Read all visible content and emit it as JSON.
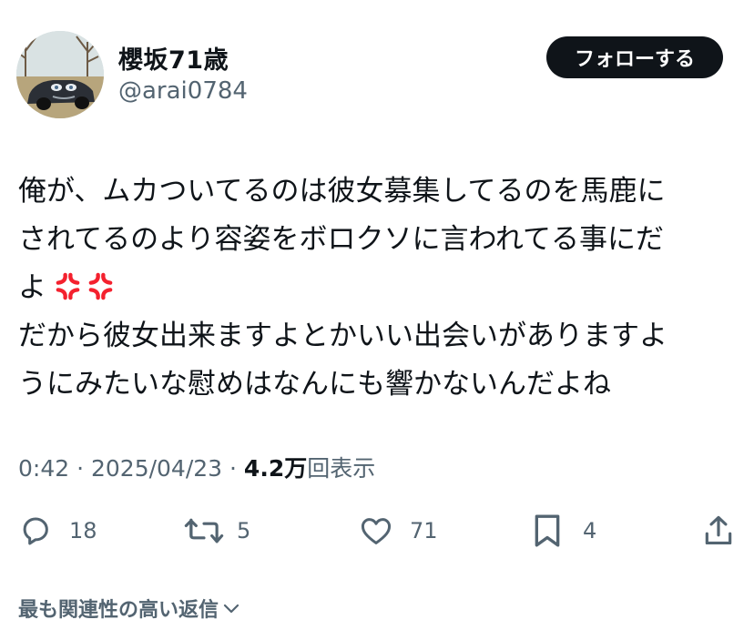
{
  "author": {
    "display_name": "櫻坂71歳",
    "handle": "@arai0784",
    "avatar_icon": "car-avatar"
  },
  "follow_label": "フォローする",
  "tweet": {
    "lines": [
      "俺が、ムカついてるのは彼女募集してるのを馬鹿に",
      "されてるのより容姿をボロクソに言われてる事にだ",
      "よ",
      "だから彼女出来ますよとかいい出会いがありますよ",
      "うにみたいな慰めはなんにも響かないんだよね"
    ],
    "emoji": "anger-symbol-icon"
  },
  "meta": {
    "time": "0:42",
    "sep1": " · ",
    "date": "2025/04/23",
    "sep2": " · ",
    "views_count": "4.2万",
    "views_label": "回表示"
  },
  "actions": {
    "reply_count": "18",
    "retweet_count": "5",
    "like_count": "71",
    "bookmark_count": "4"
  },
  "relevant_label": "最も関連性の高い返信",
  "colors": {
    "text": "#0f1419",
    "secondary": "#536471",
    "button_bg": "#0f1419",
    "anger": "#f4212e"
  }
}
